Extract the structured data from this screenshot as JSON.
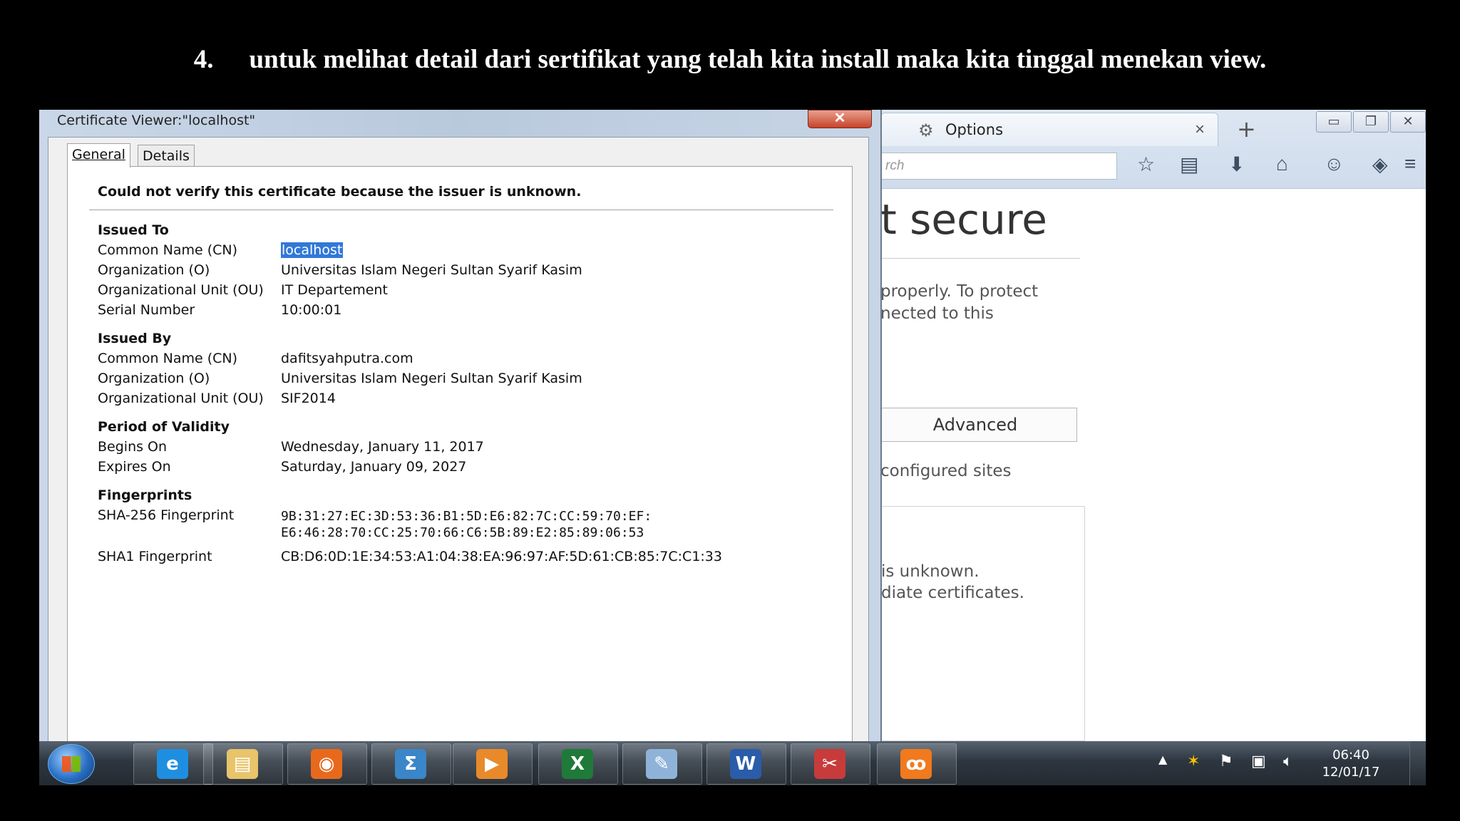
{
  "caption": {
    "number": "4.",
    "text": "untuk melihat detail dari sertifikat yang telah kita install maka kita tinggal menekan view."
  },
  "firefox": {
    "tab_title": "Options",
    "tab_close": "×",
    "new_tab": "+",
    "search_partial": "rch",
    "heading_partial": "t secure",
    "text_line1": "properly. To protect",
    "text_line2": "nected to this",
    "advanced_button": "Advanced",
    "configured_sites": "configured sites",
    "box_line1": "is unknown.",
    "box_line2": "diate certificates."
  },
  "dialog": {
    "title": "Certificate Viewer:\"localhost\"",
    "close": "✕",
    "tabs": [
      "General",
      "Details"
    ],
    "warning": "Could not verify this certificate because the issuer is unknown.",
    "issued_to": {
      "heading": "Issued To",
      "cn_label": "Common Name (CN)",
      "cn": "localhost",
      "o_label": "Organization (O)",
      "o": "Universitas Islam Negeri Sultan Syarif Kasim",
      "ou_label": "Organizational Unit (OU)",
      "ou": "IT Departement",
      "serial_label": "Serial Number",
      "serial": "10:00:01"
    },
    "issued_by": {
      "heading": "Issued By",
      "cn_label": "Common Name (CN)",
      "cn": "dafitsyahputra.com",
      "o_label": "Organization (O)",
      "o": "Universitas Islam Negeri Sultan Syarif Kasim",
      "ou_label": "Organizational Unit (OU)",
      "ou": "SIF2014"
    },
    "validity": {
      "heading": "Period of Validity",
      "begins_label": "Begins On",
      "begins": "Wednesday, January 11, 2017",
      "expires_label": "Expires On",
      "expires": "Saturday, January 09, 2027"
    },
    "fingerprints": {
      "heading": "Fingerprints",
      "sha256_label": "SHA-256 Fingerprint",
      "sha256_line1": "9B:31:27:EC:3D:53:36:B1:5D:E6:82:7C:CC:59:70:EF:",
      "sha256_line2": "E6:46:28:70:CC:25:70:66:C6:5B:89:E2:85:89:06:53",
      "sha1_label": "SHA1 Fingerprint",
      "sha1": "CB:D6:0D:1E:34:53:A1:04:38:EA:96:97:AF:5D:61:CB:85:7C:C1:33"
    }
  },
  "taskbar": {
    "clock_time": "06:40",
    "clock_date": "12/01/17",
    "apps": [
      {
        "name": "internet-explorer-icon",
        "glyph": "e",
        "color": "#1e8fe0"
      },
      {
        "name": "file-explorer-icon",
        "glyph": "▤",
        "color": "#e8c46a"
      },
      {
        "name": "firefox-icon",
        "glyph": "◉",
        "color": "#e8691c"
      },
      {
        "name": "math-input-icon",
        "glyph": "Σ",
        "color": "#3b86c8"
      },
      {
        "name": "media-player-icon",
        "glyph": "▶",
        "color": "#e98a2a"
      },
      {
        "name": "excel-icon",
        "glyph": "X",
        "color": "#1f7a3a"
      },
      {
        "name": "paint-icon",
        "glyph": "✎",
        "color": "#8fb3d8"
      },
      {
        "name": "word-icon",
        "glyph": "W",
        "color": "#2a5caa"
      },
      {
        "name": "snipping-tool-icon",
        "glyph": "✂",
        "color": "#c73b3b"
      },
      {
        "name": "xampp-icon",
        "glyph": "ꝏ",
        "color": "#f07a1d"
      }
    ]
  }
}
